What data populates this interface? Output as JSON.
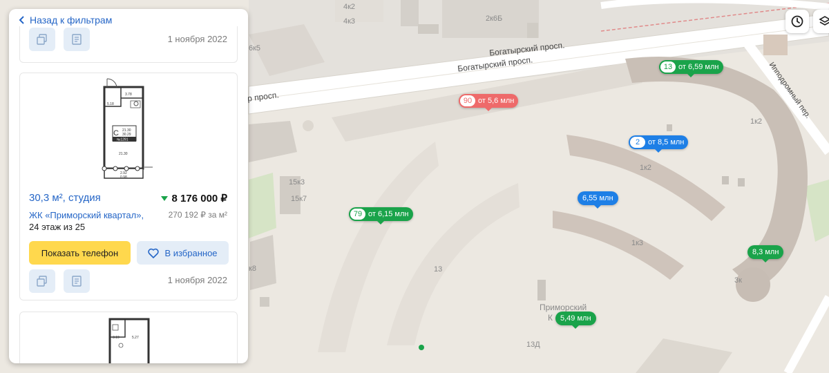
{
  "panel": {
    "back_label": "Назад к фильтрам",
    "prev_card": {
      "date": "1 ноября 2022"
    },
    "card": {
      "title": "30,3 м², студия",
      "price": "8 176 000 ₽",
      "complex": "ЖК «Приморский квартал»,",
      "floor": "24 этаж из 25",
      "price_per_m2": "270 192 ₽ за м²",
      "phone_button": "Показать телефон",
      "favorite_button": "В избранное",
      "date": "1 ноября 2022",
      "plan": {
        "room_letter": "С",
        "area_top": "21.30",
        "area_bottom": "30.29",
        "number": "№1291",
        "dim_left": "5.18",
        "dim_right": "3.78",
        "area_main": "21.30",
        "balcony_top": "2.92",
        "balcony_bottom": "0.98"
      }
    },
    "next_card": {
      "plan_dim_left": "3.19",
      "plan_dim_right": "5.27"
    }
  },
  "map": {
    "streets": [
      "Богатырский просп.",
      "Богатырский просп.",
      "Ипподромный пер.",
      "р просп."
    ],
    "labels": [
      "2к6Б",
      "4к2",
      "4к3",
      "6к5",
      "15к3",
      "15к7",
      "1к2",
      "1к3",
      "13",
      "13Д",
      "1к2",
      "3к",
      "к8"
    ],
    "poi": [
      "Приморский",
      "К"
    ],
    "pins": [
      {
        "count": "13",
        "label": "от 6,59 млн",
        "color": "green"
      },
      {
        "count": "90",
        "label": "от 5,6 млн",
        "color": "red"
      },
      {
        "count": "2",
        "label": "от 8,5 млн",
        "color": "blue"
      },
      {
        "count": "79",
        "label": "от 6,15 млн",
        "color": "green"
      },
      {
        "count": "",
        "label": "6,55 млн",
        "color": "blue"
      },
      {
        "count": "",
        "label": "8,3 млн",
        "color": "green"
      },
      {
        "count": "",
        "label": "5,49 млн",
        "color": "green"
      }
    ]
  },
  "controls": [
    "clock-icon",
    "layers-icon"
  ],
  "colors": {
    "accent": "#2566c7",
    "green": "#1aa34a",
    "blue": "#1e7fe6",
    "red": "#ee6a6a",
    "yellow": "#ffd84d"
  }
}
